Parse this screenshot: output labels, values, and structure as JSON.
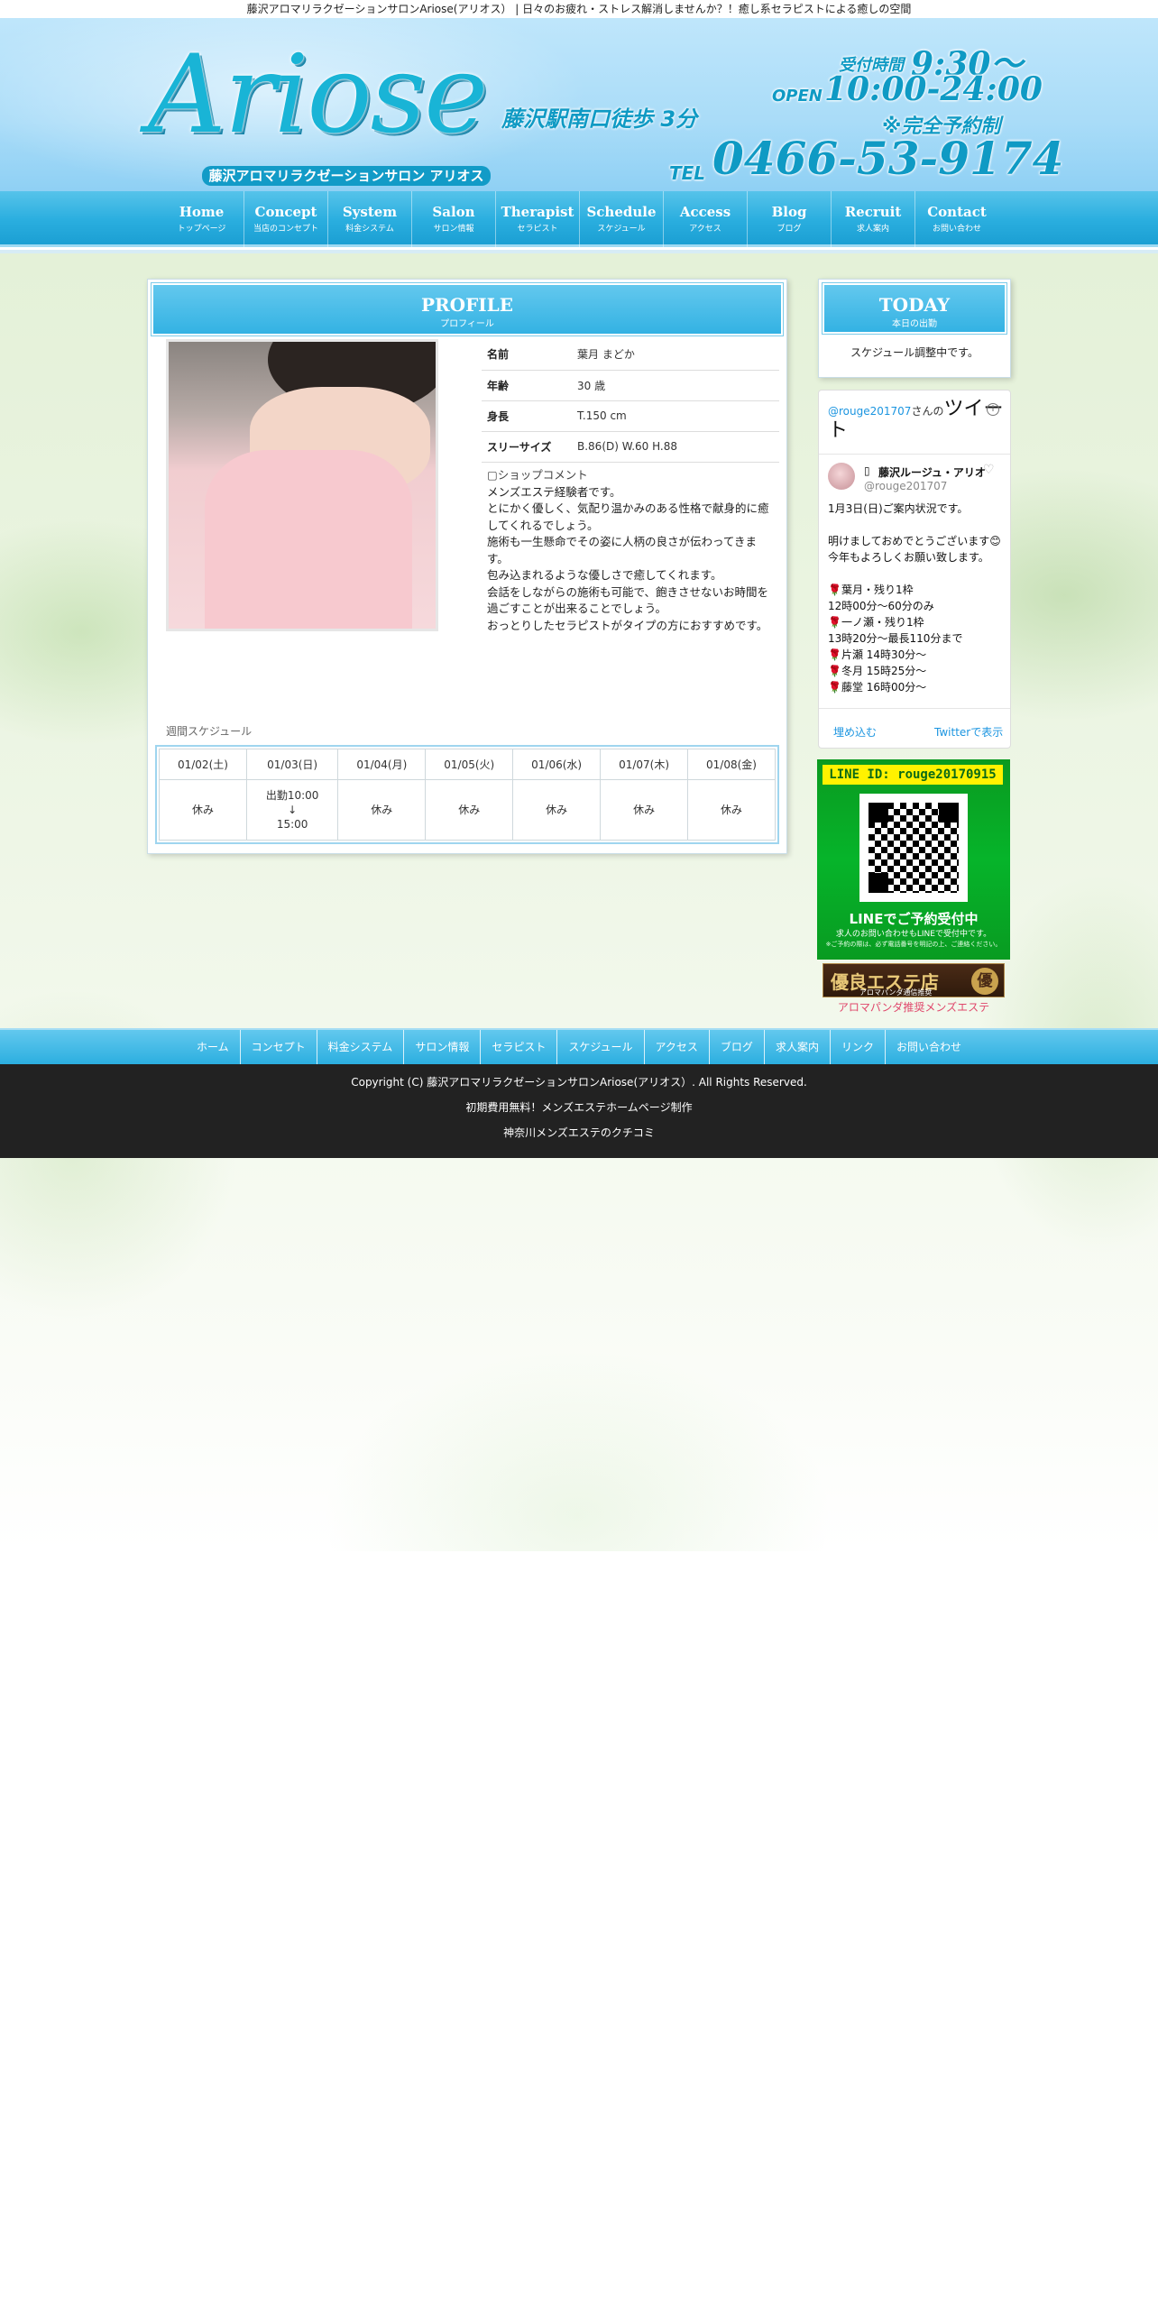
{
  "tagline": "藤沢アロマリラクゼーションサロンAriose(アリオス） | 日々のお疲れ・ストレス解消しませんか？！癒し系セラピストによる癒しの空間",
  "header": {
    "logo": "Ariose",
    "logo_sub": "藤沢アロマリラクゼーションサロン アリオス",
    "station": "藤沢駅南口徒歩 3分",
    "hours_label": "受付時間",
    "hours_time": "9:30～",
    "open_label": "OPEN",
    "open_time": "10:00-24:00",
    "reserve": "※完全予約制",
    "tel_label": "TEL",
    "tel": "0466-53-9174"
  },
  "nav": [
    {
      "en": "Home",
      "jp": "トップページ"
    },
    {
      "en": "Concept",
      "jp": "当店のコンセプト"
    },
    {
      "en": "System",
      "jp": "料金システム"
    },
    {
      "en": "Salon",
      "jp": "サロン情報"
    },
    {
      "en": "Therapist",
      "jp": "セラピスト"
    },
    {
      "en": "Schedule",
      "jp": "スケジュール"
    },
    {
      "en": "Access",
      "jp": "アクセス"
    },
    {
      "en": "Blog",
      "jp": "ブログ"
    },
    {
      "en": "Recruit",
      "jp": "求人案内"
    },
    {
      "en": "Contact",
      "jp": "お問い合わせ"
    }
  ],
  "profile": {
    "title_en": "PROFILE",
    "title_jp": "プロフィール",
    "rows": [
      {
        "k": "名前",
        "v": "葉月 まどか"
      },
      {
        "k": "年齢",
        "v": "30 歳"
      },
      {
        "k": "身長",
        "v": "T.150 cm"
      },
      {
        "k": "スリーサイズ",
        "v": "B.86(D) W.60 H.88"
      }
    ],
    "comment_label": "▢ショップコメント",
    "comment_lines": [
      "メンズエステ経験者です。",
      "とにかく優しく、気配り温かみのある性格で献身的に癒してくれるでしょう。",
      "施術も一生懸命でその姿に人柄の良さが伝わってきます。",
      "包み込まれるような優しさで癒してくれます。",
      "会話をしながらの施術も可能で、飽きさせないお時間を過ごすことが出来ることでしょう。",
      "おっとりしたセラピストがタイプの方におすすめです。"
    ]
  },
  "schedule": {
    "label": "週間スケジュール",
    "days": [
      "01/02(土)",
      "01/03(日)",
      "01/04(月)",
      "01/05(火)",
      "01/06(水)",
      "01/07(木)",
      "01/08(金)"
    ],
    "status": [
      [
        "休み"
      ],
      [
        "出勤10:00",
        "↓",
        "15:00"
      ],
      [
        "休み"
      ],
      [
        "休み"
      ],
      [
        "休み"
      ],
      [
        "休み"
      ],
      [
        "休み"
      ]
    ]
  },
  "today": {
    "title_en": "TODAY",
    "title_jp": "本日の出勤",
    "text": "スケジュール調整中です。"
  },
  "twitter": {
    "user": "@rouge201707",
    "suffix": "さんの",
    "title": "ツイート",
    "info_icon": "i",
    "name": "藤沢ルージュ・アリオ",
    "handle": "@rouge201707",
    "body": [
      "1月3日(日)ご案内状況です。",
      "",
      "明けましておめでとうございます😊",
      "今年もよろしくお願い致します。",
      "",
      "🌹葉月・残り1枠",
      "12時00分～60分のみ",
      "🌹一ノ瀬・残り1枠",
      "13時20分～最長110分まで",
      "🌹片瀬 14時30分〜",
      "🌹冬月 15時25分～",
      "🌹藤堂 16時00分～"
    ],
    "embed": "埋め込む",
    "view": "Twitterで表示"
  },
  "line": {
    "id": "LINE ID: rouge20170915",
    "title": "LINEでご予約受付中",
    "sub": "求人のお問い合わせもLINEで受付中です。",
    "note": "※ご予約の際は、必ず電話番号を明記の上、ご連絡ください。"
  },
  "yuryo": {
    "text": "優良エステ店",
    "small": "アロマパンダ通信推奨",
    "badge": "優"
  },
  "panda_link": "アロマパンダ推奨メンズエステ",
  "footer_nav": [
    "ホーム",
    "コンセプト",
    "料金システム",
    "サロン情報",
    "セラピスト",
    "スケジュール",
    "アクセス",
    "ブログ",
    "求人案内",
    "リンク",
    "お問い合わせ"
  ],
  "footer": {
    "copyright": "Copyright (C) 藤沢アロマリラクゼーションサロンAriose(アリオス）. All Rights Reserved.",
    "line2": "初期費用無料！メンズエステホームページ制作",
    "line3": "神奈川メンズエステのクチコミ"
  }
}
